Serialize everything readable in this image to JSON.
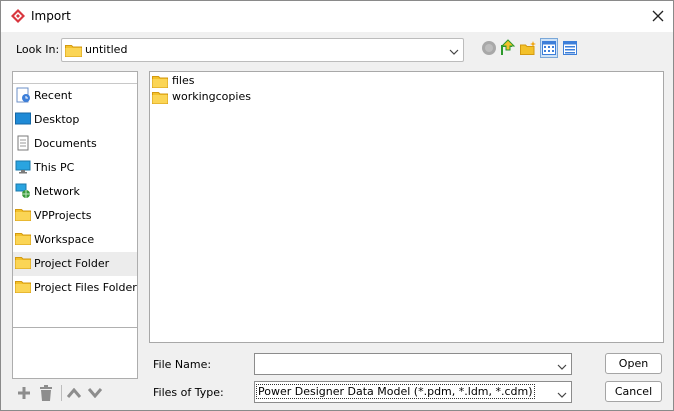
{
  "window": {
    "title": "Import"
  },
  "look_in": {
    "label": "Look In:",
    "value": "untitled"
  },
  "places": [
    {
      "label": "Recent",
      "icon": "recent-icon"
    },
    {
      "label": "Desktop",
      "icon": "desktop-icon"
    },
    {
      "label": "Documents",
      "icon": "documents-icon"
    },
    {
      "label": "This PC",
      "icon": "computer-icon"
    },
    {
      "label": "Network",
      "icon": "network-icon"
    },
    {
      "label": "VPProjects",
      "icon": "folder-icon"
    },
    {
      "label": "Workspace",
      "icon": "folder-icon"
    },
    {
      "label": "Project Folder",
      "icon": "folder-icon",
      "selected": true
    },
    {
      "label": "Project Files Folder",
      "icon": "folder-icon"
    }
  ],
  "files": [
    {
      "name": "files",
      "icon": "folder-icon"
    },
    {
      "name": "workingcopies",
      "icon": "folder-icon"
    }
  ],
  "file_name": {
    "label": "File Name:",
    "value": ""
  },
  "files_of_type": {
    "label": "Files of Type:",
    "value": "Power Designer Data Model (*.pdm, *.ldm, *.cdm)"
  },
  "buttons": {
    "open": "Open",
    "cancel": "Cancel"
  },
  "colors": {
    "folder": "#f3c12a",
    "accent": "#3d7fd9"
  }
}
